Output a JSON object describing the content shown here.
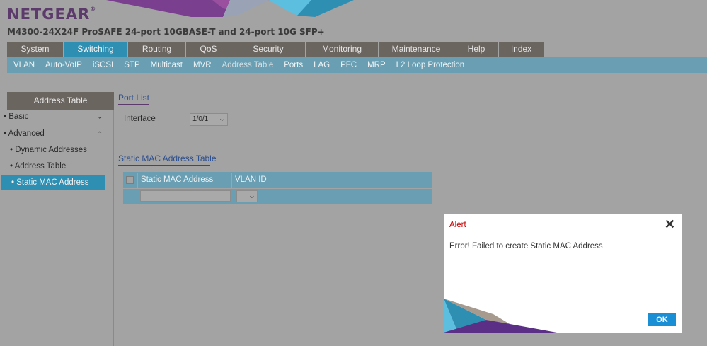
{
  "brand": {
    "logo_text": "NETGEAR",
    "logo_mark": "®"
  },
  "model_title": "M4300-24X24F ProSAFE 24-port 10GBASE-T and 24-port 10G SFP+",
  "top_nav": {
    "tabs": [
      "System",
      "Switching",
      "Routing",
      "QoS",
      "Security",
      "Monitoring",
      "Maintenance",
      "Help",
      "Index"
    ],
    "active": "Switching"
  },
  "sub_nav": {
    "items": [
      "VLAN",
      "Auto-VoIP",
      "iSCSI",
      "STP",
      "Multicast",
      "MVR",
      "Address Table",
      "Ports",
      "LAG",
      "PFC",
      "MRP",
      "L2 Loop Protection"
    ],
    "active": "Address Table"
  },
  "sidebar": {
    "header": "Address Table",
    "items": [
      {
        "label": "Basic",
        "expand_icon": "chevron-down-icon"
      },
      {
        "label": "Advanced",
        "expand_icon": "chevron-up-icon"
      },
      {
        "label": "Dynamic Addresses"
      },
      {
        "label": "Address Table"
      },
      {
        "label": "Static MAC Address"
      }
    ],
    "active": "Static MAC Address"
  },
  "port_list": {
    "title": "Port List",
    "interface_label": "Interface",
    "interface_value": "1/0/1"
  },
  "static_mac_table": {
    "title": "Static MAC Address Table",
    "columns": [
      "Static MAC Address",
      "VLAN ID"
    ],
    "new_row": {
      "mac_value": "",
      "vlan_value": ""
    }
  },
  "alert": {
    "title": "Alert",
    "message": "Error! Failed to create Static MAC Address",
    "ok_label": "OK",
    "close_icon": "close-icon"
  },
  "colors": {
    "brand_purple": "#5c3a6b",
    "active_tab": "#2e8fb3",
    "sub_nav": "#6a9fb3",
    "alert_title": "#c00000",
    "ok_button": "#1a8fd6"
  }
}
